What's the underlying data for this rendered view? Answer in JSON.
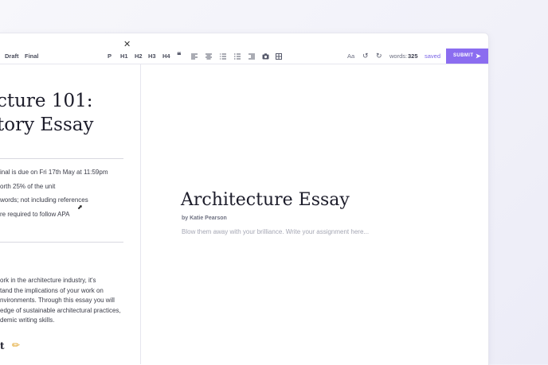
{
  "toolbar": {
    "draft": "Draft",
    "final": "Final",
    "format_buttons": [
      "P",
      "H1",
      "H2",
      "H3",
      "H4"
    ],
    "quote_icon": "quote-icon",
    "font_button": "Aa",
    "undo_icon": "undo-icon",
    "redo_icon": "redo-icon",
    "words_label": "words:",
    "words_count": "325",
    "saved": "saved",
    "submit": "SUBMIT"
  },
  "brief": {
    "title_line1": "cture 101:",
    "title_line2": "tory Essay",
    "info": [
      "inal is due on Fri 17th May at 11:59pm",
      "orth 25% of the unit",
      "words; not including references",
      "re required to follow APA"
    ],
    "paragraph": [
      "ork in the architecture industry, it's",
      "tand the implications of your work on",
      "nvironments. Through this essay you will",
      "edge of sustainable architectural practices,",
      "demic writing skills."
    ],
    "footer_word": "t",
    "pencil_icon": "pencil-icon"
  },
  "editor": {
    "title": "Architecture Essay",
    "byline": "by Katie Pearson",
    "placeholder": "Blow them away with your brilliance. Write your assignment here..."
  },
  "colors": {
    "accent": "#8b6df0",
    "saved": "#7a64e6"
  }
}
